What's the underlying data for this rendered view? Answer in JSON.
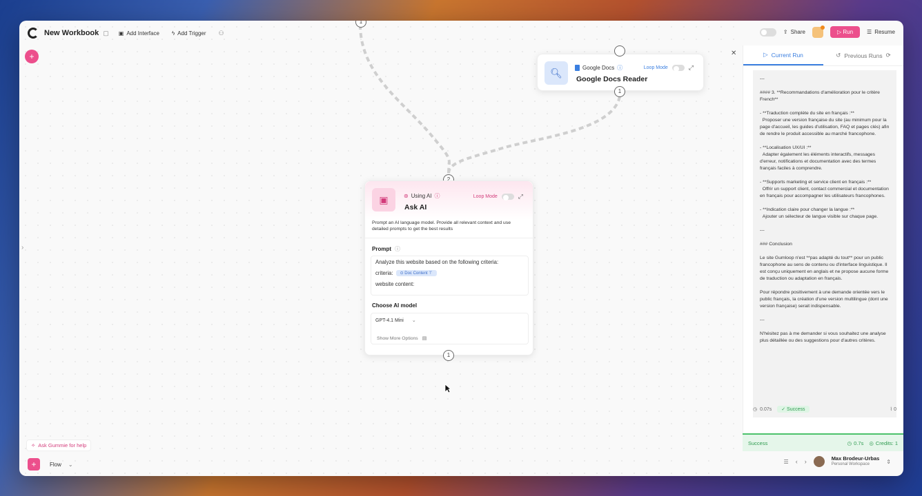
{
  "header": {
    "workbook_title": "New Workbook",
    "add_interface": "Add Interface",
    "add_trigger": "Add Trigger",
    "share": "Share",
    "run": "Run",
    "resume": "Resume"
  },
  "nodes": {
    "top_port": "1",
    "google_docs": {
      "service": "Google Docs",
      "loop_mode": "Loop Mode",
      "title": "Google Docs Reader",
      "out_port": "1"
    },
    "ask_ai": {
      "in_port": "2",
      "service": "Using AI",
      "loop_mode": "Loop Mode",
      "title": "Ask AI",
      "description": "Prompt an AI language model. Provide all relevant context and use detailed prompts to get the best results",
      "prompt_label": "Prompt",
      "prompt_line1": "Analyze this website based on the following criteria:",
      "criteria_label": "criteria:",
      "criteria_chip": "Doc Content",
      "website_label": "website content:",
      "model_label": "Choose AI model",
      "model_value": "GPT-4.1 Mini",
      "more_options": "Show More Options",
      "out_port": "1"
    }
  },
  "sidebar": {
    "tab_current": "Current Run",
    "tab_previous": "Previous Runs",
    "output_text": "---\n\n#### 3. **Recommandations d'amélioration pour le critère French**\n\n- **Traduction complète du site en français :**\n  Proposer une version française du site (au minimum pour la page d'accueil, les guides d'utilisation, FAQ et pages clés) afin de rendre le produit accessible au marché francophone.\n\n- **Localisation UX/UI :**\n  Adapter également les éléments interactifs, messages d'erreur, notifications et documentation avec des termes français faciles à comprendre.\n\n- **Supports marketing et service client en français :**\n  Offrir un support client, contact commercial et documentation en français pour accompagner les utilisateurs francophones.\n\n- **Indication claire pour changer la langue :**\n  Ajouter un sélecteur de langue visible sur chaque page.\n\n---\n\n### Conclusion\n\nLe site Gumloop n'est **pas adapté du tout** pour un public francophone au sens de contenu ou d'interface linguistique. Il est conçu uniquement en anglais et ne propose aucune forme de traduction ou adaptation en français.\n\nPour répondre positivement à une demande orientée vers le public français, la création d'une version multilingue (dont une version française) serait indispensable.\n\n---\n\nN'hésitez pas à me demander si vous souhaitez une analyse plus détaillée ou des suggestions pour d'autres critères.",
    "time": "0.07s",
    "success_badge": "Success",
    "attach_count": "0",
    "status_label": "Success",
    "status_time": "0.7s",
    "credits": "Credits: 1"
  },
  "footer": {
    "help": "Ask Gummie for help",
    "flow": "Flow",
    "user_name": "Max Brodeur-Urbas",
    "workspace": "Personal Workspace"
  },
  "colors": {
    "accent_pink": "#ec4f8c",
    "accent_blue": "#3b7fe0",
    "success_green": "#4bc16b"
  }
}
